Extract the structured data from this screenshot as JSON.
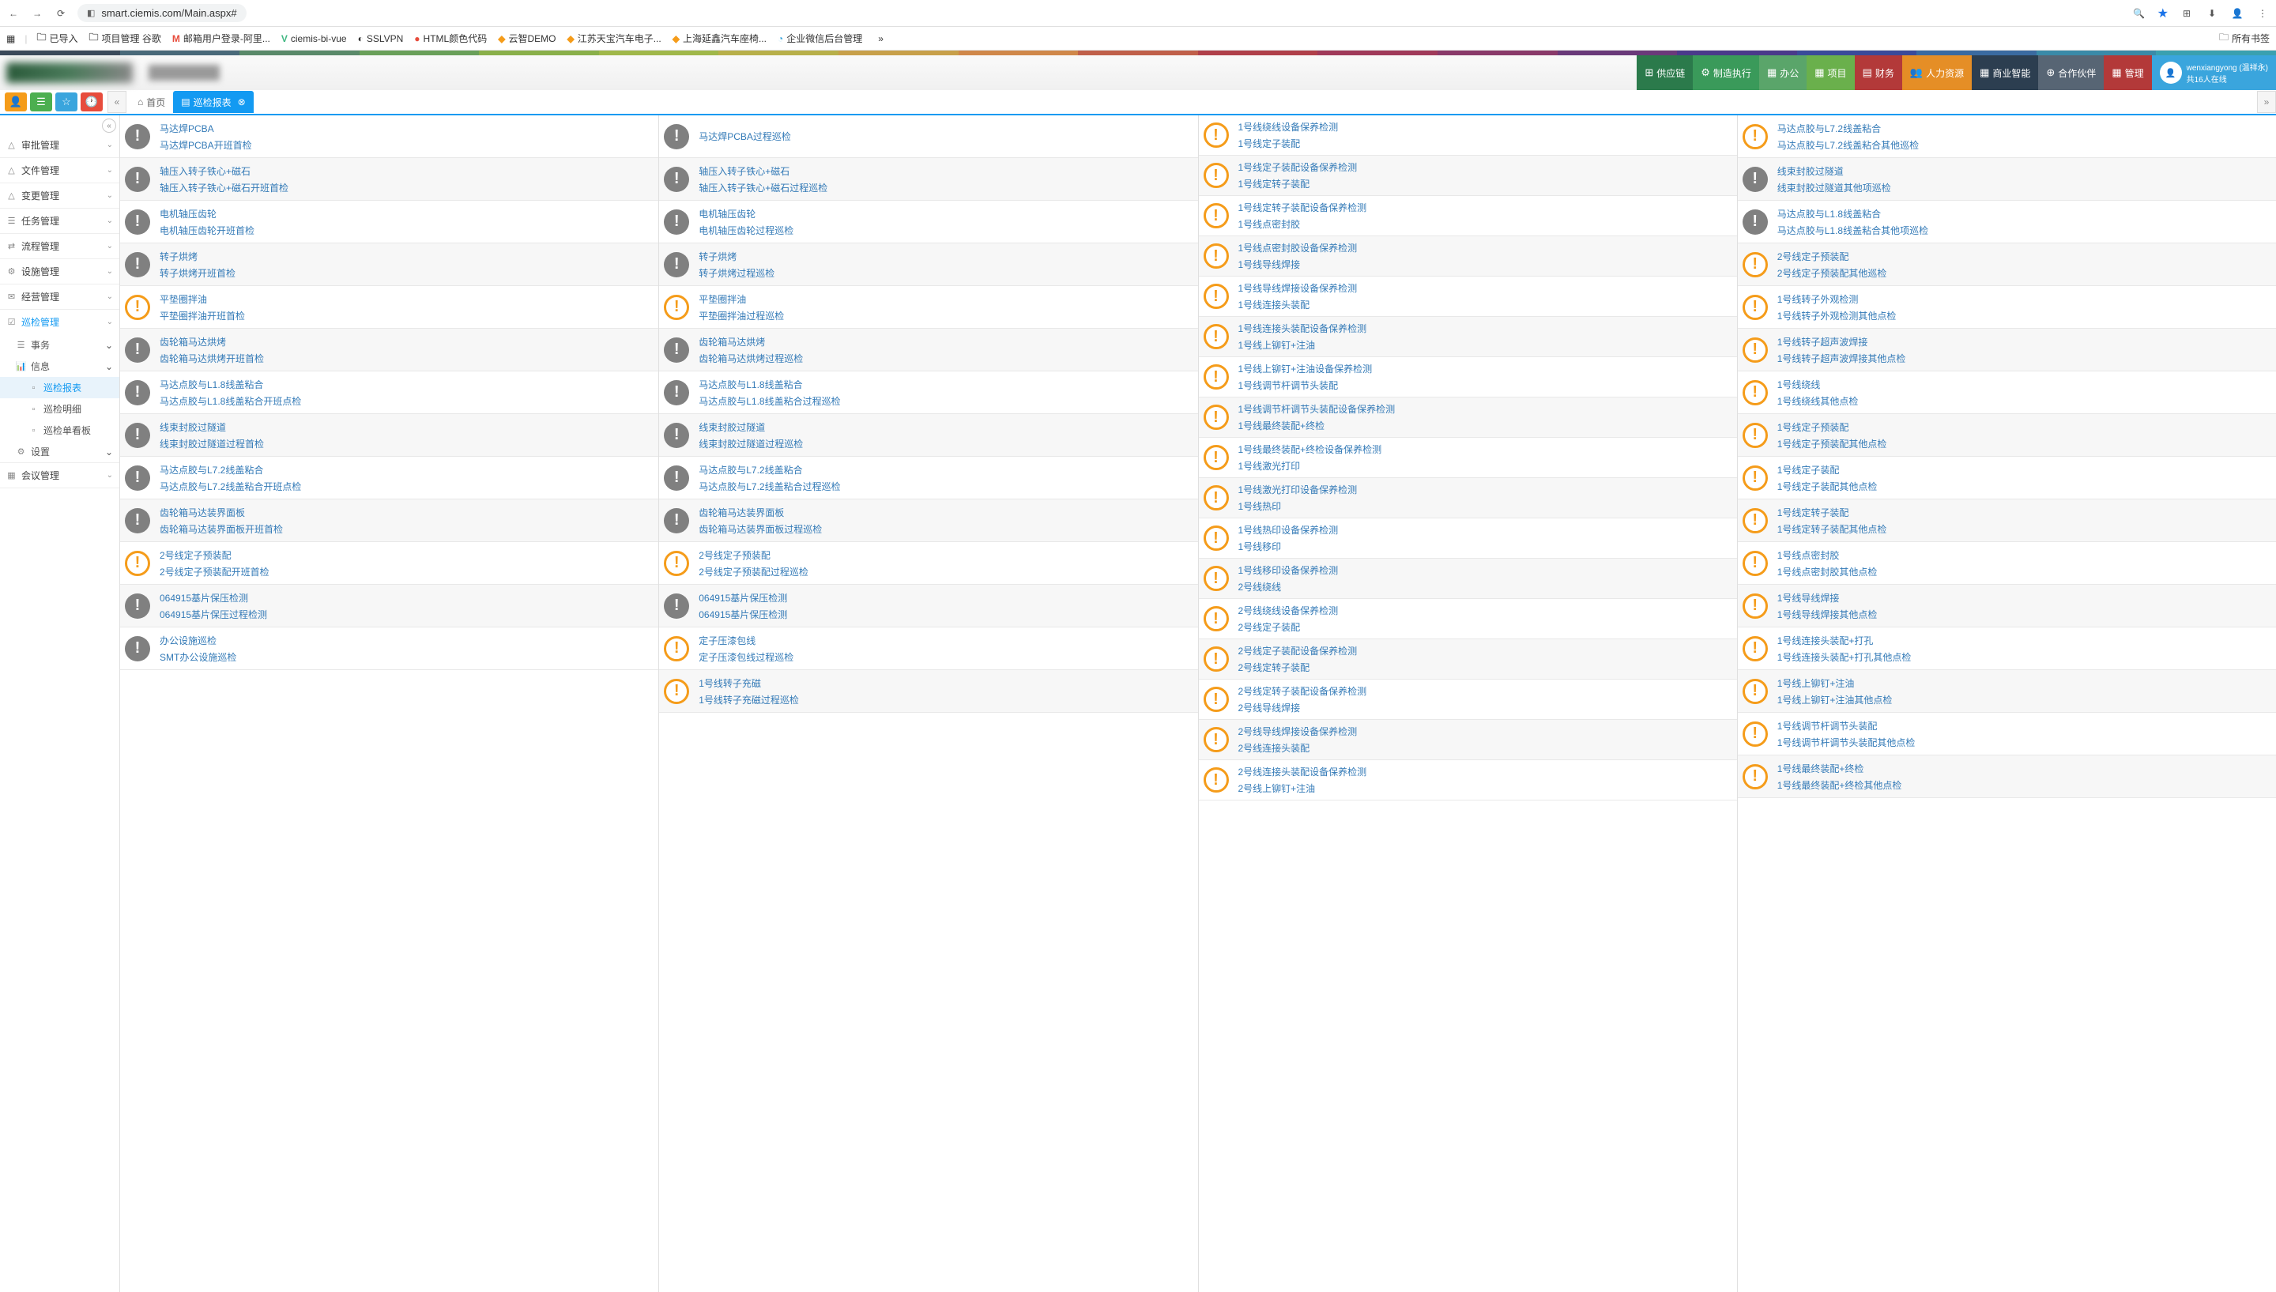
{
  "browser": {
    "url": "smart.ciemis.com/Main.aspx#",
    "bookmarks": [
      "已导入",
      "项目管理 谷歌",
      "邮箱用户登录-阿里...",
      "ciemis-bi-vue",
      "SSLVPN",
      "HTML颜色代码",
      "云智DEMO",
      "江苏天宝汽车电子...",
      "上海延鑫汽车座椅...",
      "企业微信后台管理"
    ],
    "bookmark_right": "所有书签"
  },
  "header": {
    "menus": [
      {
        "label": "供应链",
        "color": "#2b7a4b"
      },
      {
        "label": "制造执行",
        "color": "#3a9a5a"
      },
      {
        "label": "办公",
        "color": "#5aa56a"
      },
      {
        "label": "项目",
        "color": "#6ab04c"
      },
      {
        "label": "财务",
        "color": "#b33939"
      },
      {
        "label": "人力资源",
        "color": "#e58e26"
      },
      {
        "label": "商业智能",
        "color": "#2c3e50"
      },
      {
        "label": "合作伙伴",
        "color": "#576574"
      },
      {
        "label": "管理",
        "color": "#b33939"
      }
    ],
    "user_name": "wenxiangyong (温祥永)",
    "user_status": "共16人在线"
  },
  "toolbar": {
    "tabs": [
      {
        "label": "首页",
        "active": false
      },
      {
        "label": "巡检报表",
        "active": true
      }
    ]
  },
  "stripe_colors": [
    "#3b4a5a",
    "#4a6a7a",
    "#5a8a6a",
    "#6aa05a",
    "#8ab04a",
    "#a0b84a",
    "#b8b04a",
    "#c8a04a",
    "#d0884a",
    "#c0604a",
    "#b0404a",
    "#a03a5a",
    "#8a3a6a",
    "#6a3a7a",
    "#4a3a8a",
    "#3a4a9a",
    "#3a6aa0",
    "#3a8aa8",
    "#3aa0b0"
  ],
  "sidebar": {
    "groups": [
      {
        "label": "审批管理",
        "icon": "△"
      },
      {
        "label": "文件管理",
        "icon": "△"
      },
      {
        "label": "变更管理",
        "icon": "△"
      },
      {
        "label": "任务管理",
        "icon": "☰"
      },
      {
        "label": "流程管理",
        "icon": "⇄"
      },
      {
        "label": "设施管理",
        "icon": "⚙"
      },
      {
        "label": "经营管理",
        "icon": "✉"
      },
      {
        "label": "巡检管理",
        "icon": "☑",
        "active": true,
        "subs": [
          {
            "label": "事务",
            "icon": "☰",
            "expand": true
          },
          {
            "label": "信息",
            "icon": "📊",
            "expand": true,
            "items": [
              {
                "label": "巡检报表",
                "sel": true
              },
              {
                "label": "巡检明细"
              },
              {
                "label": "巡检单看板"
              }
            ]
          },
          {
            "label": "设置",
            "icon": "⚙",
            "expand": true
          }
        ]
      },
      {
        "label": "会议管理",
        "icon": "▦"
      }
    ]
  },
  "col1": [
    {
      "t": "gray",
      "l1": "马达焊PCBA",
      "l2": "马达焊PCBA开班首检"
    },
    {
      "t": "gray",
      "l1": "轴压入转子铁心+磁石",
      "l2": "轴压入转子铁心+磁石开班首检"
    },
    {
      "t": "gray",
      "l1": "电机轴压齿轮",
      "l2": "电机轴压齿轮开班首检"
    },
    {
      "t": "gray",
      "l1": "转子烘烤",
      "l2": "转子烘烤开班首检"
    },
    {
      "t": "orange",
      "l1": "平垫圈拌油",
      "l2": "平垫圈拌油开班首检"
    },
    {
      "t": "gray",
      "l1": "齿轮箱马达烘烤",
      "l2": "齿轮箱马达烘烤开班首检"
    },
    {
      "t": "gray",
      "l1": "马达点胶与L1.8线盖粘合",
      "l2": "马达点胶与L1.8线盖粘合开班点检"
    },
    {
      "t": "gray",
      "l1": "线束封胶过隧道",
      "l2": "线束封胶过隧道过程首检"
    },
    {
      "t": "gray",
      "l1": "马达点胶与L7.2线盖粘合",
      "l2": "马达点胶与L7.2线盖粘合开班点检"
    },
    {
      "t": "gray",
      "l1": "齿轮箱马达装界面板",
      "l2": "齿轮箱马达装界面板开班首检"
    },
    {
      "t": "orange",
      "l1": "2号线定子预装配",
      "l2": "2号线定子预装配开班首检"
    },
    {
      "t": "gray",
      "l1": "064915基片保压检测",
      "l2": "064915基片保压过程检测"
    },
    {
      "t": "gray",
      "l1": "办公设施巡检",
      "l2": "SMT办公设施巡检"
    }
  ],
  "col2": [
    {
      "t": "gray",
      "l1": "马达焊PCBA过程巡检",
      "single": true
    },
    {
      "t": "gray",
      "l1": "轴压入转子铁心+磁石",
      "l2": "轴压入转子铁心+磁石过程巡检"
    },
    {
      "t": "gray",
      "l1": "电机轴压齿轮",
      "l2": "电机轴压齿轮过程巡检"
    },
    {
      "t": "gray",
      "l1": "转子烘烤",
      "l2": "转子烘烤过程巡检"
    },
    {
      "t": "orange",
      "l1": "平垫圈拌油",
      "l2": "平垫圈拌油过程巡检"
    },
    {
      "t": "gray",
      "l1": "齿轮箱马达烘烤",
      "l2": "齿轮箱马达烘烤过程巡检"
    },
    {
      "t": "gray",
      "l1": "马达点胶与L1.8线盖粘合",
      "l2": "马达点胶与L1.8线盖粘合过程巡检"
    },
    {
      "t": "gray",
      "l1": "线束封胶过隧道",
      "l2": "线束封胶过隧道过程巡检"
    },
    {
      "t": "gray",
      "l1": "马达点胶与L7.2线盖粘合",
      "l2": "马达点胶与L7.2线盖粘合过程巡检"
    },
    {
      "t": "gray",
      "l1": "齿轮箱马达装界面板",
      "l2": "齿轮箱马达装界面板过程巡检"
    },
    {
      "t": "orange",
      "l1": "2号线定子预装配",
      "l2": "2号线定子预装配过程巡检"
    },
    {
      "t": "gray",
      "l1": "064915基片保压检测",
      "l2": "064915基片保压检测"
    },
    {
      "t": "orange",
      "l1": "定子压漆包线",
      "l2": "定子压漆包线过程巡检"
    },
    {
      "t": "orange",
      "l1": "1号线转子充磁",
      "l2": "1号线转子充磁过程巡检"
    }
  ],
  "col3": [
    "1号线绕线设备保养检测",
    "1号线定子装配",
    "1号线定子装配设备保养检测",
    "1号线定转子装配",
    "1号线定转子装配设备保养检测",
    "1号线点密封胶",
    "1号线点密封胶设备保养检测",
    "1号线导线焊接",
    "1号线导线焊接设备保养检测",
    "1号线连接头装配",
    "1号线连接头装配设备保养检测",
    "1号线上铆钉+注油",
    "1号线上铆钉+注油设备保养检测",
    "1号线调节杆调节头装配",
    "1号线调节杆调节头装配设备保养检测",
    "1号线最终装配+终检",
    "1号线最终装配+终检设备保养检测",
    "1号线激光打印",
    "1号线激光打印设备保养检测",
    "1号线热印",
    "1号线热印设备保养检测",
    "1号线移印",
    "1号线移印设备保养检测",
    "2号线绕线",
    "2号线绕线设备保养检测",
    "2号线定子装配",
    "2号线定子装配设备保养检测",
    "2号线定转子装配",
    "2号线定转子装配设备保养检测",
    "2号线导线焊接",
    "2号线导线焊接设备保养检测",
    "2号线连接头装配",
    "2号线连接头装配设备保养检测",
    "2号线上铆钉+注油"
  ],
  "col4": [
    {
      "l1": "马达点胶与L7.2线盖粘合",
      "l2": "马达点胶与L7.2线盖粘合其他巡检"
    },
    {
      "l1": "线束封胶过隧道",
      "l2": "线束封胶过隧道其他项巡检",
      "t": "gray"
    },
    {
      "l1": "马达点胶与L1.8线盖粘合",
      "l2": "马达点胶与L1.8线盖粘合其他项巡检",
      "t": "gray"
    },
    {
      "l1": "2号线定子预装配",
      "l2": "2号线定子预装配其他巡检"
    },
    {
      "l1": "1号线转子外观检测",
      "l2": "1号线转子外观检测其他点检"
    },
    {
      "l1": "1号线转子超声波焊接",
      "l2": "1号线转子超声波焊接其他点检"
    },
    {
      "l1": "1号线绕线",
      "l2": "1号线绕线其他点检"
    },
    {
      "l1": "1号线定子预装配",
      "l2": "1号线定子预装配其他点检"
    },
    {
      "l1": "1号线定子装配",
      "l2": "1号线定子装配其他点检"
    },
    {
      "l1": "1号线定转子装配",
      "l2": "1号线定转子装配其他点检"
    },
    {
      "l1": "1号线点密封胶",
      "l2": "1号线点密封胶其他点检"
    },
    {
      "l1": "1号线导线焊接",
      "l2": "1号线导线焊接其他点检"
    },
    {
      "l1": "1号线连接头装配+打孔",
      "l2": "1号线连接头装配+打孔其他点检"
    },
    {
      "l1": "1号线上铆钉+注油",
      "l2": "1号线上铆钉+注油其他点检"
    },
    {
      "l1": "1号线调节杆调节头装配",
      "l2": "1号线调节杆调节头装配其他点检"
    },
    {
      "l1": "1号线最终装配+终检",
      "l2": "1号线最终装配+终检其他点检"
    }
  ]
}
